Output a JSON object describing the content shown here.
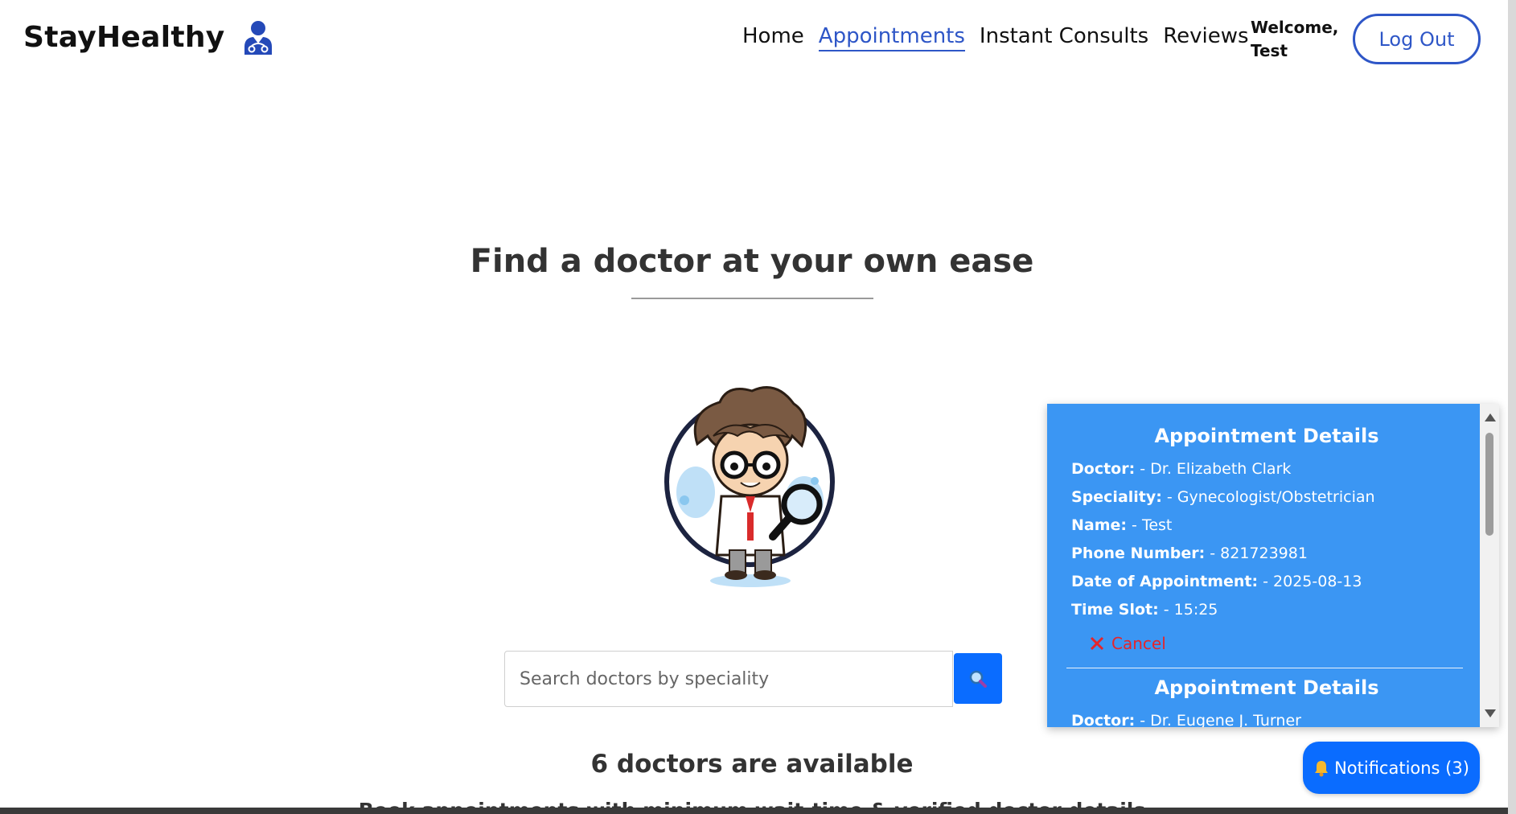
{
  "brand": {
    "name": "StayHealthy",
    "icon": "doctor-icon"
  },
  "nav": {
    "links": [
      {
        "label": "Home",
        "active": false
      },
      {
        "label": "Appointments",
        "active": true
      },
      {
        "label": "Instant Consults",
        "active": false
      },
      {
        "label": "Reviews",
        "active": false
      }
    ]
  },
  "user": {
    "welcome_line1": "Welcome,",
    "welcome_line2": "Test",
    "logout_label": "Log Out"
  },
  "hero": {
    "title": "Find a doctor at your own ease"
  },
  "search": {
    "placeholder": "Search doctors by speciality",
    "button_icon": "search-icon"
  },
  "results": {
    "available_text": "6 doctors are available",
    "subtitle": "Book appointments with minimum wait-time & verified doctor details"
  },
  "appointments": [
    {
      "title": "Appointment Details",
      "doctor_label": "Doctor:",
      "doctor": " - Dr. Elizabeth Clark",
      "speciality_label": "Speciality:",
      "speciality": " - Gynecologist/Obstetrician",
      "name_label": "Name:",
      "name": " - Test",
      "phone_label": "Phone Number:",
      "phone": " - 821723981",
      "date_label": "Date of Appointment:",
      "date": " - 2025-08-13",
      "slot_label": "Time Slot:",
      "slot": " - 15:25",
      "cancel_label": "Cancel"
    },
    {
      "title": "Appointment Details",
      "doctor_label": "Doctor:",
      "doctor": " - Dr. Eugene J. Turner"
    }
  ],
  "notifications": {
    "label": "Notifications (3)",
    "icon": "bell-icon"
  },
  "colors": {
    "accent": "#2e56c7",
    "panel": "#3b96f3",
    "button": "#0a6cff",
    "cancel": "#e5242b"
  }
}
